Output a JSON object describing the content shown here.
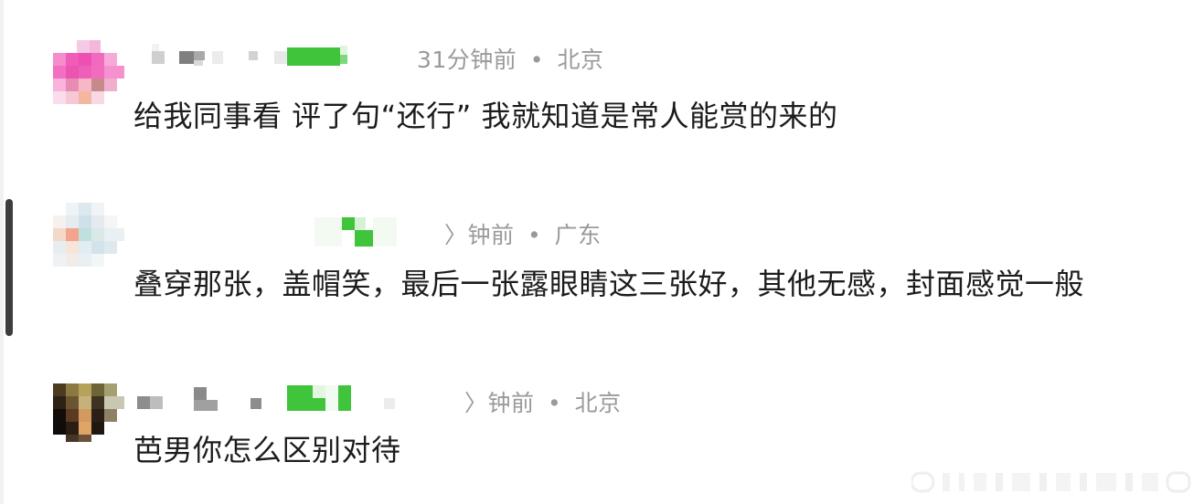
{
  "comments": [
    {
      "time": "31分钟前",
      "separator": "•",
      "location": "北京",
      "text": "给我同事看 评了句“还行” 我就知道是常人能赏的来的"
    },
    {
      "time": "〉钟前",
      "separator": "•",
      "location": "广东",
      "text": "叠穿那张，盖帽笑，最后一张露眼睛这三张好，其他无感，封面感觉一般"
    },
    {
      "time": "〉钟前",
      "separator": "•",
      "location": "北京",
      "text": "芭男你怎么区别对待"
    }
  ],
  "colors": {
    "meta_text": "#9a9a9a",
    "body_text": "#1c1c1c",
    "scrollbar": "#3d3d3d",
    "mosaic_green": "#3fc43c"
  }
}
